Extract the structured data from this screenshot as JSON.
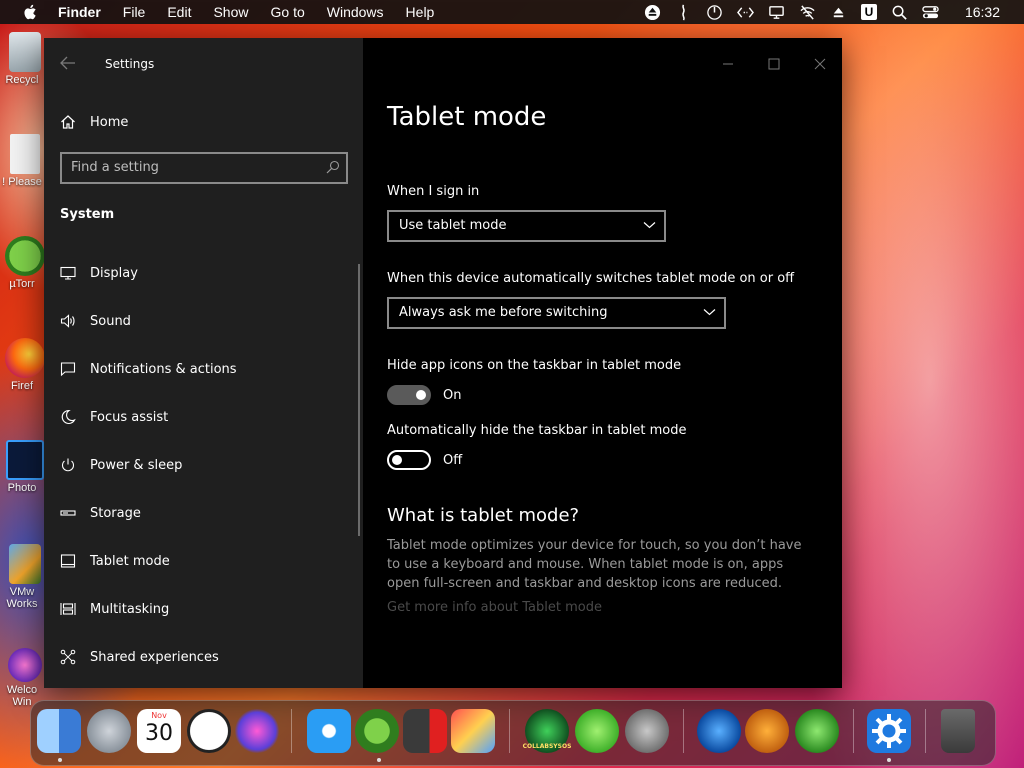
{
  "menubar": {
    "items": [
      "Finder",
      "File",
      "Edit",
      "Show",
      "Go to",
      "Windows",
      "Help"
    ],
    "status_icons": [
      "eject-icon",
      "battery-status-icon",
      "power-icon",
      "code-icon",
      "display-icon",
      "wifi-off-icon",
      "eject-icon",
      "u-app-icon",
      "search-icon",
      "control-center-icon"
    ],
    "u_label": "U",
    "clock": "16:32"
  },
  "desktop": {
    "icons": [
      {
        "label": "Recycl",
        "icon": "recycle-bin-icon"
      },
      {
        "label": "! Please",
        "icon": "document-icon"
      },
      {
        "label": "µTorr",
        "icon": "utorrent-icon"
      },
      {
        "label": "Firef",
        "icon": "firefox-icon"
      },
      {
        "label": "Photo",
        "icon": "photoshop-icon"
      },
      {
        "label": "VMw Works",
        "icon": "vmware-icon"
      },
      {
        "label": "Welco Win",
        "icon": "welcome-icon"
      }
    ]
  },
  "settings": {
    "app_title": "Settings",
    "home_label": "Home",
    "search_placeholder": "Find a setting",
    "section_label": "System",
    "nav": [
      {
        "label": "Display",
        "icon": "monitor-icon"
      },
      {
        "label": "Sound",
        "icon": "speaker-icon"
      },
      {
        "label": "Notifications & actions",
        "icon": "notification-icon"
      },
      {
        "label": "Focus assist",
        "icon": "moon-icon"
      },
      {
        "label": "Power & sleep",
        "icon": "power-icon"
      },
      {
        "label": "Storage",
        "icon": "storage-icon"
      },
      {
        "label": "Tablet mode",
        "icon": "tablet-icon"
      },
      {
        "label": "Multitasking",
        "icon": "multitasking-icon"
      },
      {
        "label": "Shared experiences",
        "icon": "shared-icon"
      }
    ],
    "page": {
      "title": "Tablet mode",
      "signin_label": "When I sign in",
      "signin_value": "Use tablet mode",
      "switch_label": "When this device automatically switches tablet mode on or off",
      "switch_value": "Always ask me before switching",
      "hide_icons_label": "Hide app icons on the taskbar in tablet mode",
      "hide_icons_state": "On",
      "hide_taskbar_label": "Automatically hide the taskbar in tablet mode",
      "hide_taskbar_state": "Off",
      "what_title": "What is tablet mode?",
      "what_desc": "Tablet mode optimizes your device for touch, so you don’t have to use a keyboard and mouse. When tablet mode is on, apps open full-screen and taskbar and desktop icons are reduced.",
      "more_link": "Get more info about Tablet mode"
    }
  },
  "dock": {
    "apps": [
      "finder-icon",
      "launchpad-icon",
      "calendar-icon",
      "clock-icon",
      "siri-icon",
      "safari-icon",
      "utorrent-icon",
      "parallels-icon",
      "photo-booth-icon",
      "collabsysos-icon",
      "link-icon",
      "utilities-icon",
      "www-icon",
      "download-icon",
      "network-icon",
      "system-preferences-icon",
      "trash-icon"
    ],
    "calendar_month": "Nov",
    "calendar_day": "30",
    "collab_label": "COLLABSYSOS"
  }
}
